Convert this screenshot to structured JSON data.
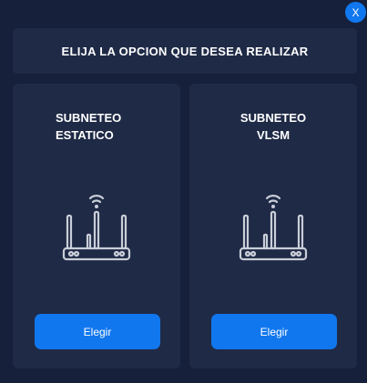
{
  "close_button": {
    "label": "X"
  },
  "header": {
    "title": "ELIJA LA OPCION QUE DESEA REALIZAR"
  },
  "options": [
    {
      "title_line1": "SUBNETEO",
      "title_line2": "ESTATICO",
      "icon": "router-icon",
      "button_label": "Elegir"
    },
    {
      "title_line1": "SUBNETEO",
      "title_line2": "VLSM",
      "icon": "router-icon",
      "button_label": "Elegir"
    }
  ],
  "colors": {
    "background": "#16203a",
    "panel": "#1f2a46",
    "accent": "#1177ee",
    "text": "#ffffff",
    "icon": "#c9ced8"
  }
}
